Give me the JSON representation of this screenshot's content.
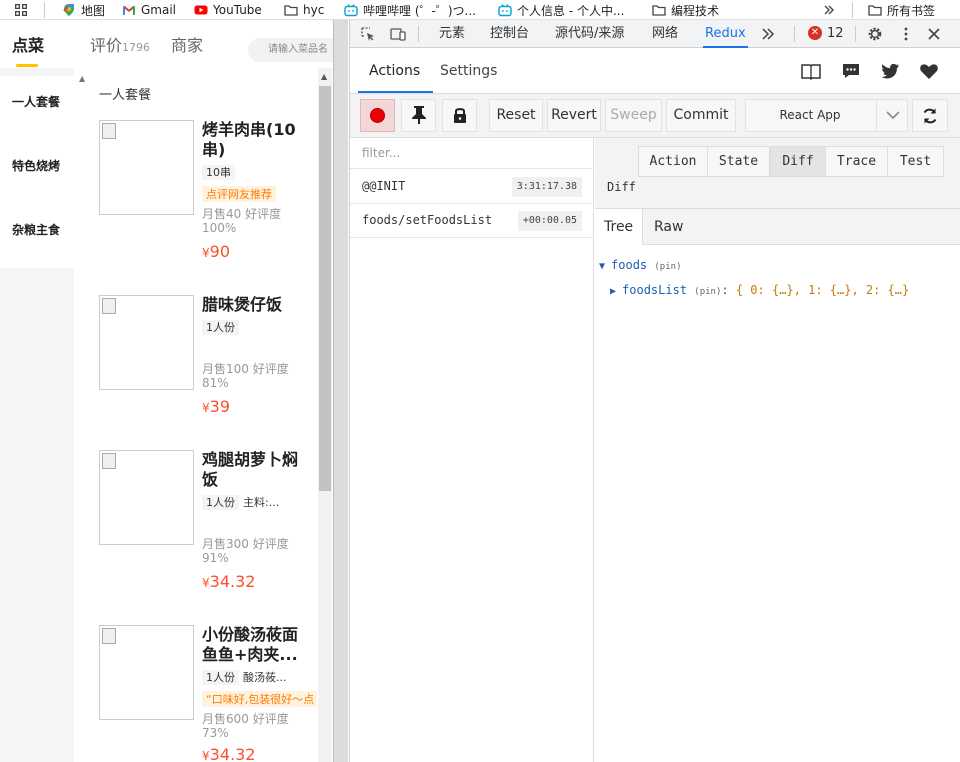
{
  "bookmarks": {
    "items": [
      {
        "label": "地图",
        "icon": "maps-icon"
      },
      {
        "label": "Gmail",
        "icon": "gmail-icon"
      },
      {
        "label": "YouTube",
        "icon": "youtube-icon"
      },
      {
        "label": "hyc",
        "icon": "folder-icon"
      },
      {
        "label": "哔哩哔哩 (゜-゜)つ...",
        "icon": "bilibili-icon"
      },
      {
        "label": "个人信息 - 个人中...",
        "icon": "bilibili-icon"
      },
      {
        "label": "编程技术",
        "icon": "folder-icon"
      }
    ],
    "all_bookmarks": "所有书签"
  },
  "app": {
    "tabs": {
      "order": "点菜",
      "reviews": "评价",
      "reviews_count": "1796",
      "merchant": "商家"
    },
    "search_placeholder": "请输入菜品名",
    "categories": [
      "一人套餐",
      "特色烧烤",
      "杂粮主食"
    ],
    "list_title": "一人套餐",
    "foods": [
      {
        "name": "烤羊肉串(10串)",
        "unit": "10串",
        "desc": "",
        "promo": "点评网友推荐",
        "sales": "月售40",
        "rating": "好评度100%",
        "price": "90"
      },
      {
        "name": "腊味煲仔饭",
        "unit": "1人份",
        "desc": "",
        "promo": "",
        "sales": "月售100",
        "rating": "好评度81%",
        "price": "39"
      },
      {
        "name": "鸡腿胡萝卜焖饭",
        "unit": "1人份",
        "desc": "主料:...",
        "promo": "",
        "sales": "月售300",
        "rating": "好评度91%",
        "price": "34.32"
      },
      {
        "name": "小份酸汤莜面鱼鱼+肉夹...",
        "unit": "1人份",
        "desc": "酸汤莜...",
        "promo": "“口味好,包装很好～点",
        "sales": "月售600",
        "rating": "好评度73%",
        "price": "34.32"
      }
    ],
    "currency": "¥"
  },
  "devtools": {
    "tabs": [
      "元素",
      "控制台",
      "源代码/来源",
      "网络",
      "Redux"
    ],
    "active_tab": "Redux",
    "error_count": "12",
    "redux": {
      "tabs": [
        "Actions",
        "Settings"
      ],
      "toolbar": {
        "reset": "Reset",
        "revert": "Revert",
        "sweep": "Sweep",
        "commit": "Commit",
        "app_select": "React App"
      },
      "filter_placeholder": "filter...",
      "actions": [
        {
          "name": "@@INIT",
          "time": "3:31:17.38"
        },
        {
          "name": "foods/setFoodsList",
          "time": "+00:00.05"
        }
      ],
      "monitor_tabs": [
        "Action",
        "State",
        "Diff",
        "Trace",
        "Test"
      ],
      "active_monitor": "Diff",
      "diff_label": "Diff",
      "view_tabs": [
        "Tree",
        "Raw"
      ],
      "tree": {
        "root_key": "foods",
        "root_tag": "(pin)",
        "child_key": "foodsList",
        "child_tag": "(pin)",
        "child_value": "{ 0: {…}, 1: {…}, 2: {…}"
      }
    }
  }
}
